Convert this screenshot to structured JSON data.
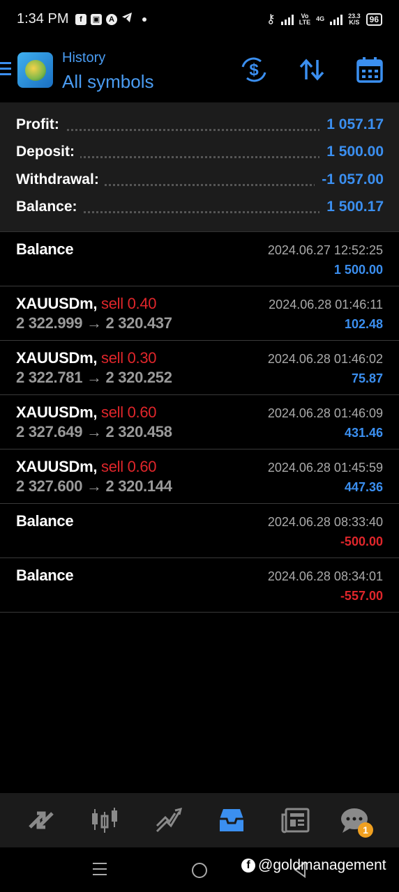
{
  "status_bar": {
    "time": "1:34 PM",
    "net_label_1": "Vo\nLTE",
    "net_label_2": "4G",
    "speed": "23.3\nK/S",
    "battery": "96",
    "icons": [
      "facebook-icon",
      "app-icon",
      "vpn-icon",
      "telegram-icon",
      "key-icon",
      "signal-icon"
    ]
  },
  "app_bar": {
    "subtitle": "History",
    "title": "All symbols",
    "actions": [
      "deposit-icon",
      "sort-icon",
      "calendar-icon"
    ]
  },
  "summary": [
    {
      "label": "Profit:",
      "value": "1 057.17"
    },
    {
      "label": "Deposit:",
      "value": "1 500.00"
    },
    {
      "label": "Withdrawal:",
      "value": "-1 057.00"
    },
    {
      "label": "Balance:",
      "value": "1 500.17"
    }
  ],
  "entries": [
    {
      "title": "Balance",
      "side": "",
      "prices": "",
      "time": "2024.06.27 12:52:25",
      "amount": "1 500.00",
      "negative": false
    },
    {
      "title": "XAUUSDm,",
      "side": "sell 0.40",
      "prices": "2 322.999 → 2 320.437",
      "time": "2024.06.28 01:46:11",
      "amount": "102.48",
      "negative": false
    },
    {
      "title": "XAUUSDm,",
      "side": "sell 0.30",
      "prices": "2 322.781 → 2 320.252",
      "time": "2024.06.28 01:46:02",
      "amount": "75.87",
      "negative": false
    },
    {
      "title": "XAUUSDm,",
      "side": "sell 0.60",
      "prices": "2 327.649 → 2 320.458",
      "time": "2024.06.28 01:46:09",
      "amount": "431.46",
      "negative": false
    },
    {
      "title": "XAUUSDm,",
      "side": "sell 0.60",
      "prices": "2 327.600 → 2 320.144",
      "time": "2024.06.28 01:45:59",
      "amount": "447.36",
      "negative": false
    },
    {
      "title": "Balance",
      "side": "",
      "prices": "",
      "time": "2024.06.28 08:33:40",
      "amount": "-500.00",
      "negative": true
    },
    {
      "title": "Balance",
      "side": "",
      "prices": "",
      "time": "2024.06.28 08:34:01",
      "amount": "-557.00",
      "negative": true
    }
  ],
  "bottom_nav": {
    "items": [
      "quotes-icon",
      "chart-icon",
      "trade-icon",
      "history-icon",
      "news-icon",
      "chat-icon"
    ],
    "active": "history-icon",
    "chat_badge": "1"
  },
  "watermark": "@goldmanagement",
  "colors": {
    "accent": "#3b8ff0",
    "negative": "#e0262b",
    "panel": "#1c1c1c"
  }
}
